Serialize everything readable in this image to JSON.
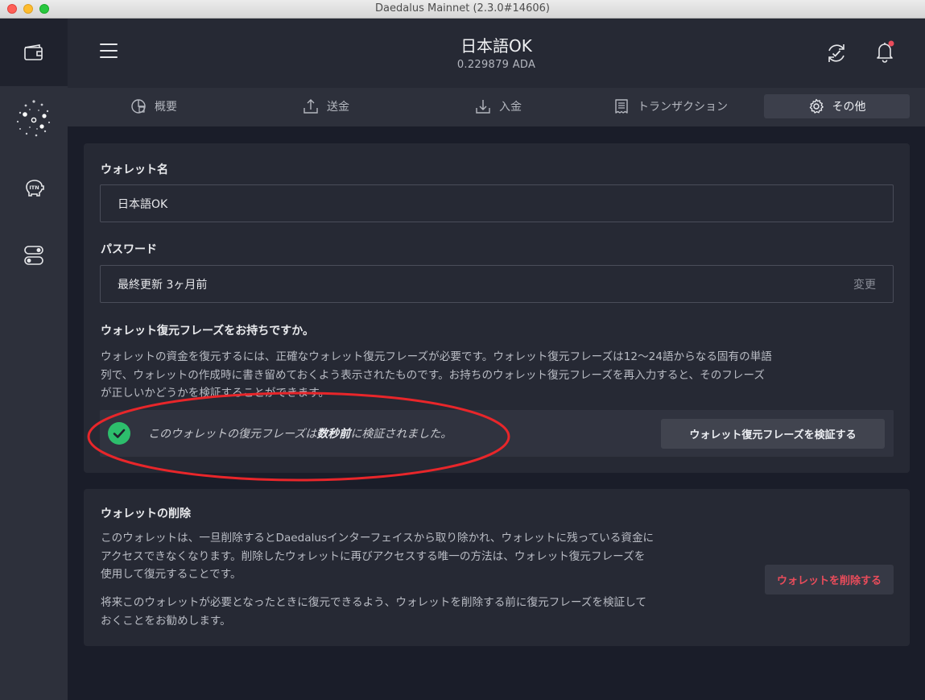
{
  "window": {
    "title": "Daedalus Mainnet (2.3.0#14606)"
  },
  "header": {
    "wallet_name": "日本語OK",
    "balance": "0.229879 ADA"
  },
  "tabs": [
    {
      "label": "概要",
      "icon": "summary-icon"
    },
    {
      "label": "送金",
      "icon": "send-icon"
    },
    {
      "label": "入金",
      "icon": "receive-icon"
    },
    {
      "label": "トランザクション",
      "icon": "transactions-icon"
    },
    {
      "label": "その他",
      "icon": "gear-icon",
      "active": true
    }
  ],
  "settings": {
    "wallet_name_label": "ウォレット名",
    "wallet_name_value": "日本語OK",
    "password_label": "パスワード",
    "password_value": "最終更新 3ヶ月前",
    "password_change": "変更",
    "recovery_title": "ウォレット復元フレーズをお持ちですか。",
    "recovery_desc_1": "ウォレットの資金を復元するには、正確なウォレット復元フレーズが必要です。ウォレット復元フレーズは12〜24語からなる固有の単語",
    "recovery_desc_2": "列で、ウォレットの作成時に書き留めておくよう表示されたものです。お持ちのウォレット復元フレーズを再入力すると、そのフレーズ",
    "recovery_desc_3": "が正しいかどうかを検証することができます。",
    "verify_status_pre": "このウォレットの復元フレーズは",
    "verify_status_time": "数秒前",
    "verify_status_post": "に検証されました。",
    "verify_button": "ウォレット復元フレーズを検証する"
  },
  "delete": {
    "title": "ウォレットの削除",
    "desc_1": "このウォレットは、一旦削除するとDaedalusインターフェイスから取り除かれ、ウォレットに残っている資金に",
    "desc_2": "アクセスできなくなります。削除したウォレットに再びアクセスする唯一の方法は、ウォレット復元フレーズを",
    "desc_3": "使用して復元することです。",
    "desc_4": "将来このウォレットが必要となったときに復元できるよう、ウォレットを削除する前に復元フレーズを検証して",
    "desc_5": "おくことをお勧めします。",
    "button": "ウォレットを削除する"
  },
  "colors": {
    "accent_success": "#2dbe6c",
    "danger": "#ea4c5b",
    "annotation": "#e8262a",
    "notification_dot": "#ea4c5b"
  }
}
